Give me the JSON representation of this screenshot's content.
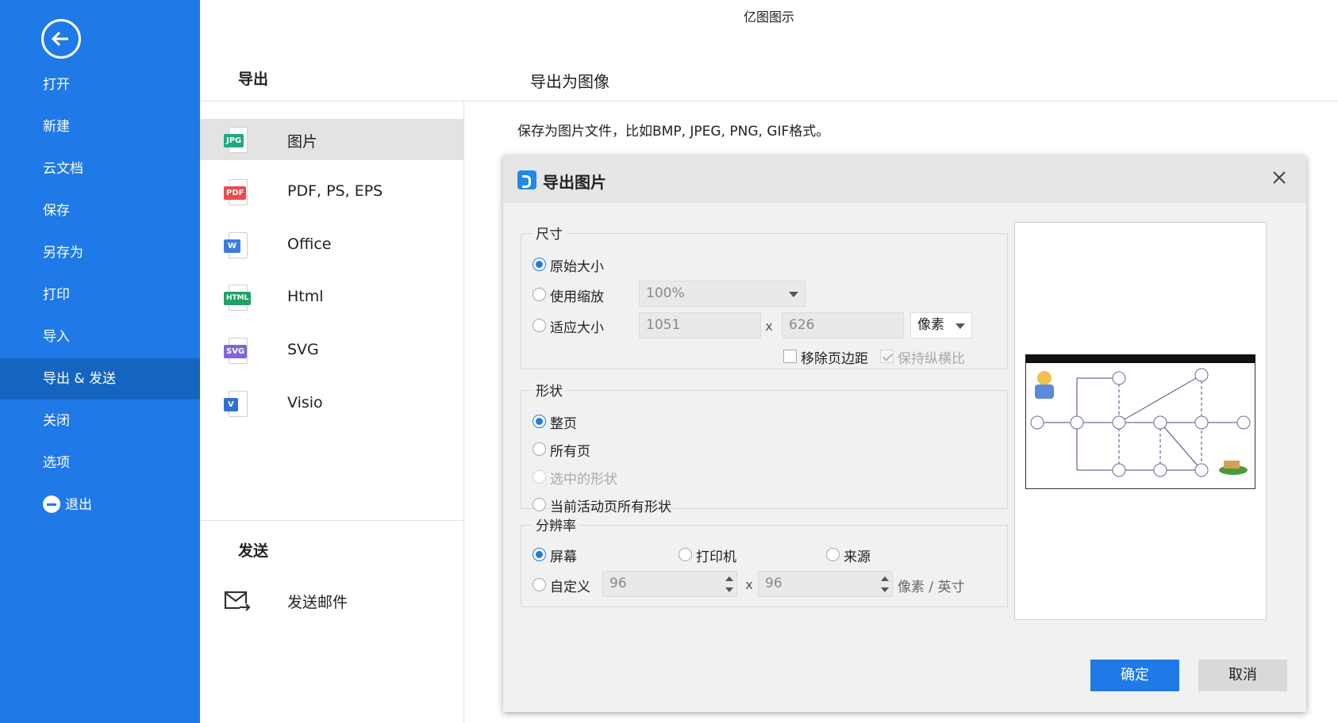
{
  "app_title": "亿图图示",
  "sidebar": {
    "items": [
      {
        "label": "打开"
      },
      {
        "label": "新建"
      },
      {
        "label": "云文档"
      },
      {
        "label": "保存"
      },
      {
        "label": "另存为"
      },
      {
        "label": "打印"
      },
      {
        "label": "导入"
      },
      {
        "label": "导出 & 发送",
        "active": true
      },
      {
        "label": "关闭"
      },
      {
        "label": "选项"
      },
      {
        "label": "退出"
      }
    ]
  },
  "export_section": {
    "heading": "导出",
    "formats": [
      {
        "label": "图片",
        "tag": "JPG",
        "color": "#1fa882",
        "active": true
      },
      {
        "label": "PDF, PS, EPS",
        "tag": "PDF",
        "color": "#ef4b4b"
      },
      {
        "label": "Office",
        "tag": "W",
        "color": "#3a7de0"
      },
      {
        "label": "Html",
        "tag": "HTML",
        "color": "#20a266"
      },
      {
        "label": "SVG",
        "tag": "SVG",
        "color": "#7f65d8"
      },
      {
        "label": "Visio",
        "tag": "V",
        "color": "#2f6fd6"
      }
    ]
  },
  "send_section": {
    "heading": "发送",
    "items": [
      {
        "label": "发送邮件",
        "icon": "mail-send-icon"
      }
    ]
  },
  "main": {
    "title": "导出为图像",
    "description": "保存为图片文件，比如BMP, JPEG, PNG, GIF格式。"
  },
  "dialog": {
    "title": "导出图片",
    "size_group": {
      "title": "尺寸",
      "original_label": "原始大小",
      "scale_label": "使用缩放",
      "scale_value": "100%",
      "fit_label": "适应大小",
      "width_value": "1051",
      "height_value": "626",
      "separator": "x",
      "unit_value": "像素",
      "remove_margin_label": "移除页边距",
      "keep_ratio_label": "保持纵横比"
    },
    "shape_group": {
      "title": "形状",
      "whole_page_label": "整页",
      "all_pages_label": "所有页",
      "selected_label": "选中的形状",
      "active_page_label": "当前活动页所有形状"
    },
    "resolution_group": {
      "title": "分辨率",
      "screen_label": "屏幕",
      "printer_label": "打印机",
      "source_label": "来源",
      "custom_label": "自定义",
      "dpi_x": "96",
      "dpi_y": "96",
      "separator": "x",
      "unit_label": "像素 / 英寸"
    },
    "ok_label": "确定",
    "cancel_label": "取消"
  },
  "accent_color": "#1f7ae8"
}
